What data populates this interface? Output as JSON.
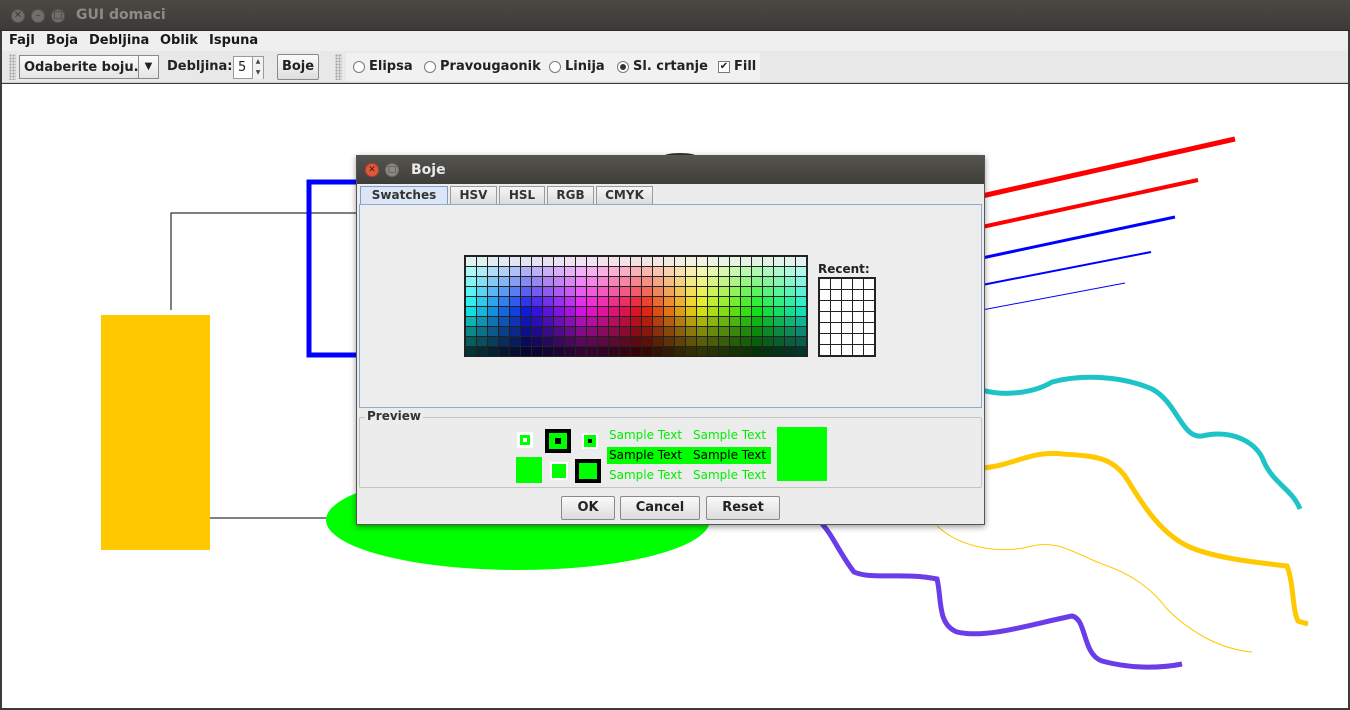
{
  "window": {
    "title": "GUI domaci"
  },
  "menubar": {
    "items": [
      "Fajl",
      "Boja",
      "Debljina",
      "Oblik",
      "Ispuna"
    ]
  },
  "toolbar": {
    "color_combo": "Odaberite boju.",
    "thickness_label": "Debljina:",
    "thickness_value": "5",
    "colors_button": "Boje",
    "shapes": [
      {
        "label": "Elipsa",
        "selected": false
      },
      {
        "label": "Pravougaonik",
        "selected": false
      },
      {
        "label": "Linija",
        "selected": false
      },
      {
        "label": "Sl. crtanje",
        "selected": true
      }
    ],
    "fill_label": "Fill",
    "fill_checked": true
  },
  "dialog": {
    "title": "Boje",
    "tabs": [
      "Swatches",
      "HSV",
      "HSL",
      "RGB",
      "CMYK"
    ],
    "active_tab": "Swatches",
    "recent_label": "Recent:",
    "preview_label": "Preview",
    "sample_text": "Sample Text",
    "selected_color": "#00ff00",
    "buttons": {
      "ok": "OK",
      "cancel": "Cancel",
      "reset": "Reset"
    }
  },
  "colors": {
    "selected": "#00ff00",
    "canvas": "#ffffff",
    "yellow": "#ffc800",
    "blue": "#0000ff",
    "red": "#ff0000",
    "cyan": "#1ec3c8",
    "purple": "#6a3de8"
  }
}
